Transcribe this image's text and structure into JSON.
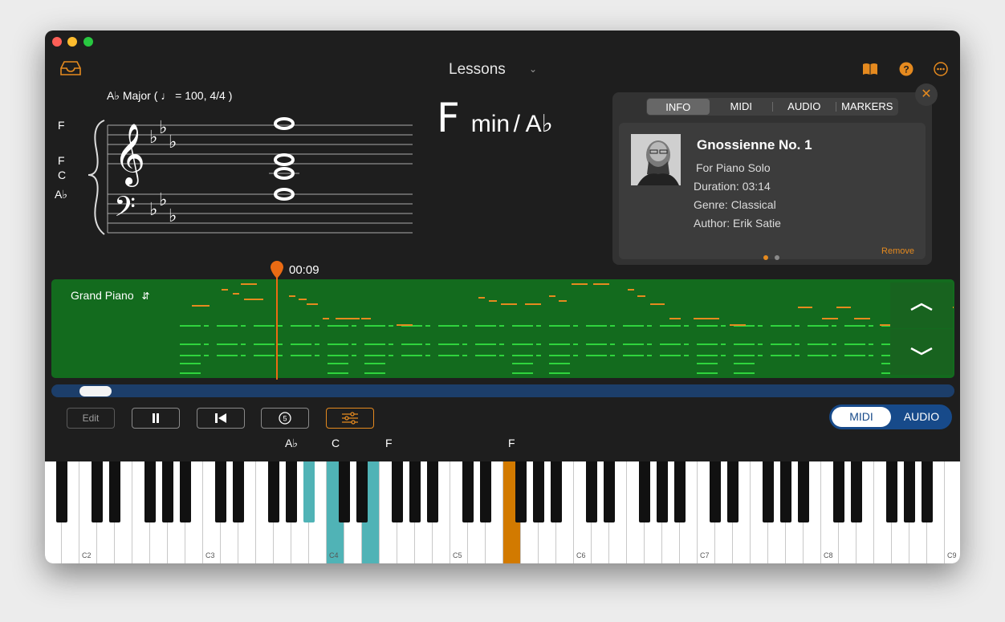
{
  "header": {
    "title": "Lessons"
  },
  "staff": {
    "key_signature": "A♭ Major ( ♩ = 100, 4/4 )",
    "note_names": [
      "F",
      "F",
      "C",
      "A♭"
    ]
  },
  "chord": {
    "root": "F",
    "quality": "min",
    "bass": "/ A♭"
  },
  "info_panel": {
    "tabs": [
      "INFO",
      "MIDI",
      "AUDIO",
      "MARKERS"
    ],
    "active_tab": "INFO",
    "song": {
      "title": "Gnossienne No. 1",
      "subtitle": "For Piano Solo",
      "duration": "Duration: 03:14",
      "genre": "Genre:  Classical",
      "author": "Author:  Erik Satie"
    },
    "remove_label": "Remove",
    "page_dots": 2,
    "current_page": 1
  },
  "pianoroll": {
    "instrument": "Grand Piano",
    "playhead_time": "00:09"
  },
  "controls": {
    "edit_label": "Edit"
  },
  "mode_toggle": {
    "midi": "MIDI",
    "audio": "AUDIO",
    "selected": "MIDI"
  },
  "keyboard": {
    "active_keys": [
      "A♭",
      "C",
      "F",
      "F"
    ],
    "octave_labels": [
      "C2",
      "C3",
      "C4",
      "C5",
      "C6",
      "C7",
      "C8",
      "C9"
    ]
  },
  "colors": {
    "accent": "#e58a1f",
    "pianoroll_bg": "#136b1e",
    "toggle_bg": "#174a8a",
    "highlight_key": "#50b3b6",
    "current_key": "#d27a00"
  }
}
